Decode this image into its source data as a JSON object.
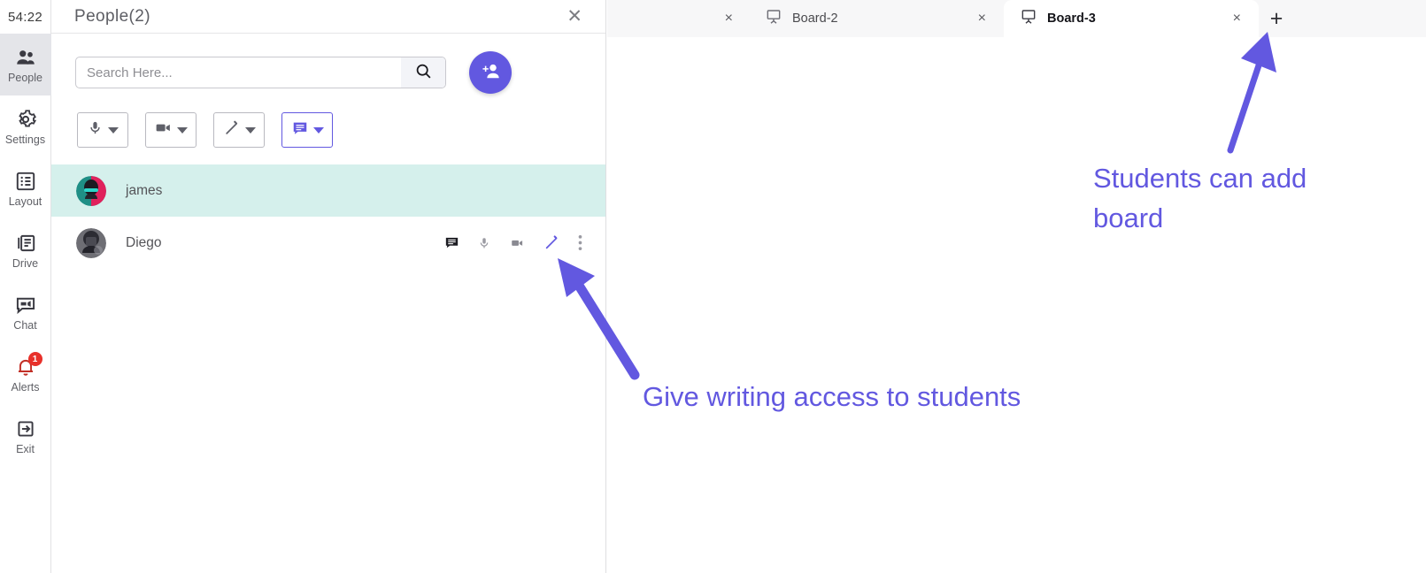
{
  "sidebar": {
    "timer": "54:22",
    "items": [
      {
        "label": "People",
        "icon": "people-icon",
        "active": true,
        "badge": null
      },
      {
        "label": "Settings",
        "icon": "gear-icon",
        "active": false,
        "badge": null
      },
      {
        "label": "Layout",
        "icon": "layout-icon",
        "active": false,
        "badge": null
      },
      {
        "label": "Drive",
        "icon": "drive-icon",
        "active": false,
        "badge": null
      },
      {
        "label": "Chat",
        "icon": "chat-icon",
        "active": false,
        "badge": null
      },
      {
        "label": "Alerts",
        "icon": "bell-icon",
        "active": false,
        "badge": "1"
      },
      {
        "label": "Exit",
        "icon": "exit-icon",
        "active": false,
        "badge": null
      }
    ]
  },
  "panel": {
    "title": "People(2)",
    "close_icon": "close-icon",
    "search": {
      "placeholder": "Search Here...",
      "value": "",
      "button_icon": "search-icon"
    },
    "add_person_icon": "add-person-icon",
    "tools": [
      {
        "name": "microphone-dropdown",
        "icon": "microphone-icon",
        "active": false
      },
      {
        "name": "video-dropdown",
        "icon": "video-camera-icon",
        "active": false
      },
      {
        "name": "pencil-dropdown",
        "icon": "pencil-icon",
        "active": false
      },
      {
        "name": "chat-dropdown",
        "icon": "chat-bubble-icon",
        "active": true
      }
    ],
    "people": [
      {
        "name": "james",
        "highlighted": true,
        "avatar_colors": [
          "#1f8f86",
          "#e0215c",
          "#1b1b22"
        ],
        "actions": []
      },
      {
        "name": "Diego",
        "highlighted": false,
        "avatar_colors": [
          "#6e6e74",
          "#2c2c33",
          "#9b9ba2"
        ],
        "actions": [
          {
            "name": "chat-icon",
            "color": "#1c1c22"
          },
          {
            "name": "microphone-icon",
            "color": "#9a9aa2"
          },
          {
            "name": "video-camera-icon",
            "color": "#8a8a92"
          },
          {
            "name": "pencil-icon",
            "color": "#6258e0"
          },
          {
            "name": "more-options-icon",
            "color": "#9a9aa2"
          }
        ]
      }
    ]
  },
  "tabs": {
    "items": [
      {
        "label": "",
        "icon": "board-icon",
        "active": false,
        "truncated": true
      },
      {
        "label": "Board-2",
        "icon": "board-icon",
        "active": false,
        "truncated": false
      },
      {
        "label": "Board-3",
        "icon": "board-icon",
        "active": true,
        "truncated": false
      }
    ],
    "close_label": "×",
    "add_label": "+",
    "add_icon": "plus-icon"
  },
  "annotations": {
    "color": "#6258e0",
    "add_board": "Students can add\nboard",
    "writing_access": "Give writing access to students"
  }
}
